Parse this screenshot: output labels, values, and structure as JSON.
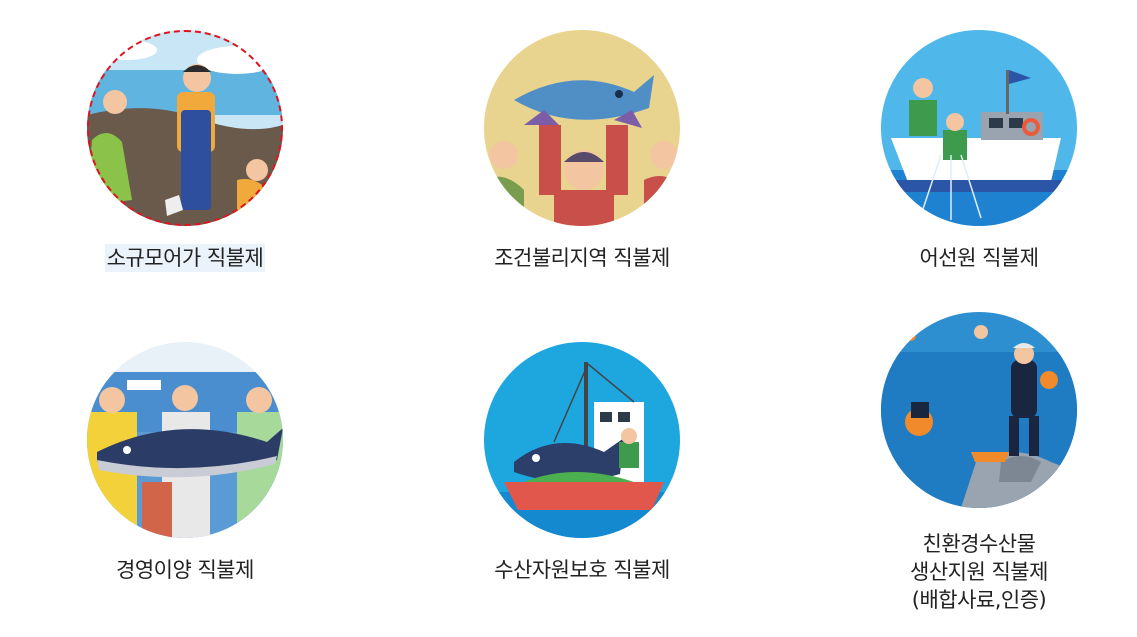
{
  "programs": [
    {
      "label": "소규모어가 직불제",
      "focused": true
    },
    {
      "label": "조건불리지역 직불제",
      "focused": false
    },
    {
      "label": "어선원 직불제",
      "focused": false
    },
    {
      "label": "경영이양 직불제",
      "focused": false
    },
    {
      "label": "수산자원보호 직불제",
      "focused": false
    },
    {
      "label_lines": [
        "친환경수산물",
        "생산지원 직불제",
        "(배합사료,인증)"
      ],
      "focused": false
    }
  ],
  "colors": {
    "focus_outline": "#e0141e",
    "focus_label_bg": "#eaf2fb"
  }
}
